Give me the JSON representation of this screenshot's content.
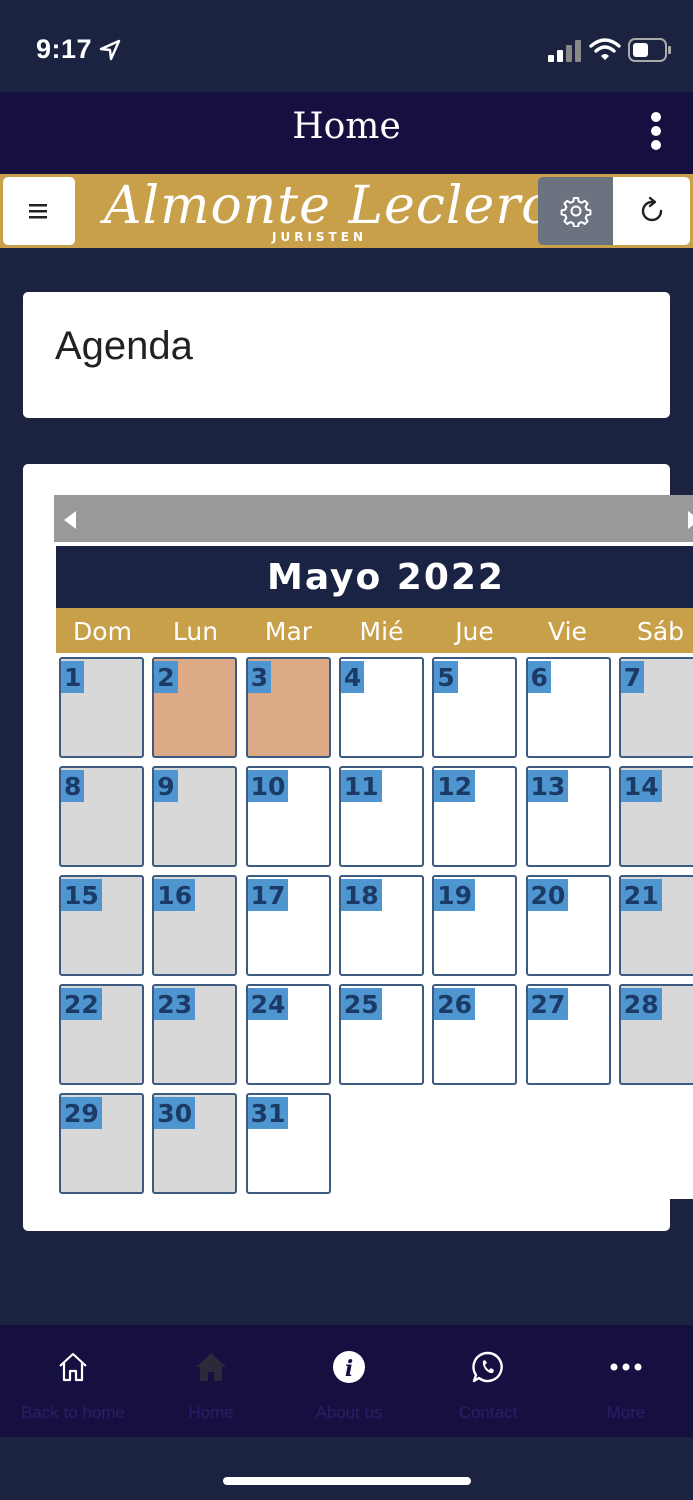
{
  "status_bar": {
    "time": "9:17",
    "icons": [
      "location-arrow-icon",
      "signal-icon",
      "wifi-icon",
      "battery-icon"
    ]
  },
  "header": {
    "title": "Home",
    "more_icon": "kebab-menu-icon"
  },
  "banner": {
    "logo_text": "Almonte Leclerc",
    "logo_subtitle": "JURISTEN",
    "menu_icon": "hamburger-icon",
    "settings_icon": "gear-icon",
    "refresh_icon": "refresh-icon",
    "colors": {
      "gold": "#c9a04a",
      "settings_bg": "#6b7280"
    }
  },
  "page": {
    "title": "Agenda"
  },
  "calendar": {
    "month_label": "Mayo 2022",
    "weekdays": [
      "Dom",
      "Lun",
      "Mar",
      "Mié",
      "Jue",
      "Vie",
      "Sáb"
    ],
    "days": [
      "1",
      "2",
      "3",
      "4",
      "5",
      "6",
      "7",
      "8",
      "9",
      "10",
      "11",
      "12",
      "13",
      "14",
      "15",
      "16",
      "17",
      "18",
      "19",
      "20",
      "21",
      "22",
      "23",
      "24",
      "25",
      "26",
      "27",
      "28",
      "29",
      "30",
      "31"
    ],
    "event_days": [
      "2",
      "3"
    ],
    "colors": {
      "header_bg": "#1b2344",
      "weekday_bg": "#c9a04a",
      "weekend_bg": "#d8d8d8",
      "event_bg": "#dcaa86",
      "day_number_bg": "#4f95cf"
    }
  },
  "bottom_nav": {
    "items": [
      {
        "label": "Back to home",
        "icon": "house-outline-icon"
      },
      {
        "label": "Home",
        "icon": "house-filled-icon"
      },
      {
        "label": "About us",
        "icon": "info-icon"
      },
      {
        "label": "Contact",
        "icon": "whatsapp-icon"
      },
      {
        "label": "More",
        "icon": "more-dots-icon"
      }
    ]
  }
}
